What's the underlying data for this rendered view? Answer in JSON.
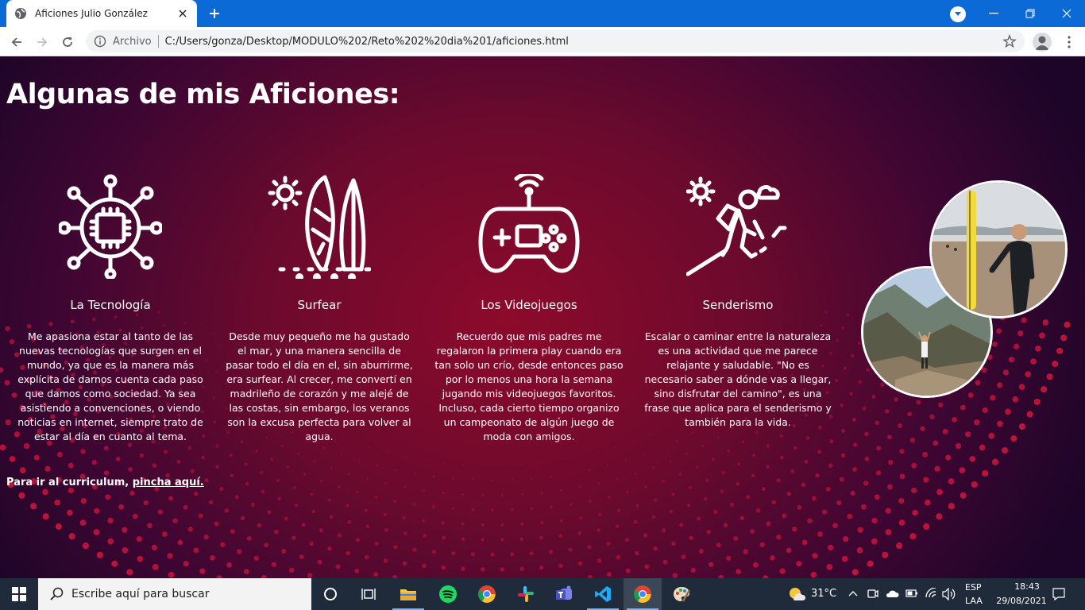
{
  "browser": {
    "tab_title": "Aficiones Julio González",
    "url_scheme": "Archivo",
    "url": "C:/Users/gonza/Desktop/MODULO%202/Reto%202%20dia%201/aficiones.html"
  },
  "page": {
    "title": "Algunas de mis Aficiones:",
    "hobbies": [
      {
        "name": "La Tecnología",
        "icon": "chip-network-icon",
        "text": "Me apasiona estar al tanto de las nuevas tecnologías que surgen en el mundo, ya que es la manera más explícita de darnos cuenta cada paso que damos como sociedad. Ya sea asistiendo a convenciones, o viendo noticias en internet, siempre trato de estar al día en cuanto al tema."
      },
      {
        "name": "Surfear",
        "icon": "surfboards-icon",
        "text": "Desde muy pequeño me ha gustado el mar, y una manera sencilla de pasar todo el día en el, sin aburrirme, era surfear. Al crecer, me convertí en madrileño de corazón y me alejé de las costas, sin embargo, los veranos son la excusa perfecta para volver al agua."
      },
      {
        "name": "Los Videojuegos",
        "icon": "gamepad-icon",
        "text": "Recuerdo que mis padres me regalaron la primera play cuando era tan solo un crío, desde entonces paso por lo menos una hora la semana jugando mis videojuegos favoritos. Incluso, cada cierto tiempo organizo un campeonato de algún juego de moda con amigos."
      },
      {
        "name": "Senderismo",
        "icon": "hiker-icon",
        "text": "Escalar o caminar entre la naturaleza es una actividad que me parece relajante y saludable. \"No es necesario saber a dónde vas a llegar, sino disfrutar del camino\", es una frase que aplica para el senderismo y también para la vida."
      }
    ],
    "cv_prefix": "Para ir al curriculum, ",
    "cv_link": "pincha aquí."
  },
  "taskbar": {
    "search_placeholder": "Escribe aquí para buscar",
    "weather": "31°C",
    "lang_1": "ESP",
    "lang_2": "LAA",
    "time": "18:43",
    "date": "29/08/2021",
    "apps": [
      "task-view",
      "file-explorer",
      "spotify",
      "chrome",
      "slack",
      "teams",
      "vscode",
      "chrome-active",
      "paint"
    ]
  },
  "colors": {
    "tabstrip": "#0b6ad6",
    "taskbar": "#1f2b3a",
    "page_center": "#8d0a2c",
    "page_edge": "#1c0528"
  }
}
